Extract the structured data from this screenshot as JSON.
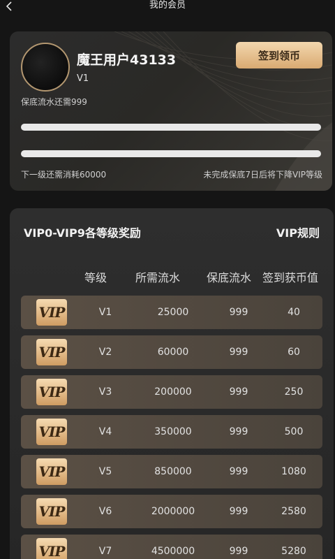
{
  "topbar": {
    "title": "我的会员"
  },
  "profile": {
    "username": "魔王用户43133",
    "vip_level": "V1",
    "signin_button": "签到领币",
    "guarantee_text": "保底流水还需999",
    "progress_1": 0,
    "progress_2": 0,
    "next_level_text": "下一级还需消耗60000",
    "downgrade_text": "未完成保底7日后将下降VIP等级"
  },
  "rewards": {
    "title": "VIP0-VIP9各等级奖励",
    "rules_link": "VIP规则",
    "headers": {
      "level": "等级",
      "required_flow": "所需流水",
      "guarantee_flow": "保底流水",
      "signin_coins": "签到获币值"
    },
    "badge_text": "VIP",
    "rows": [
      {
        "level": "V1",
        "required_flow": "25000",
        "guarantee_flow": "999",
        "signin_coins": "40"
      },
      {
        "level": "V2",
        "required_flow": "60000",
        "guarantee_flow": "999",
        "signin_coins": "60"
      },
      {
        "level": "V3",
        "required_flow": "200000",
        "guarantee_flow": "999",
        "signin_coins": "250"
      },
      {
        "level": "V4",
        "required_flow": "350000",
        "guarantee_flow": "999",
        "signin_coins": "500"
      },
      {
        "level": "V5",
        "required_flow": "850000",
        "guarantee_flow": "999",
        "signin_coins": "1080"
      },
      {
        "level": "V6",
        "required_flow": "2000000",
        "guarantee_flow": "999",
        "signin_coins": "2580"
      },
      {
        "level": "V7",
        "required_flow": "4500000",
        "guarantee_flow": "999",
        "signin_coins": "5280"
      }
    ]
  },
  "colors": {
    "accent_gold": "#d9aa72",
    "row_bg": "#5b5045",
    "background": "#151515"
  },
  "icons": {
    "back": "chevron-left-icon",
    "badge": "vip-badge-icon"
  }
}
